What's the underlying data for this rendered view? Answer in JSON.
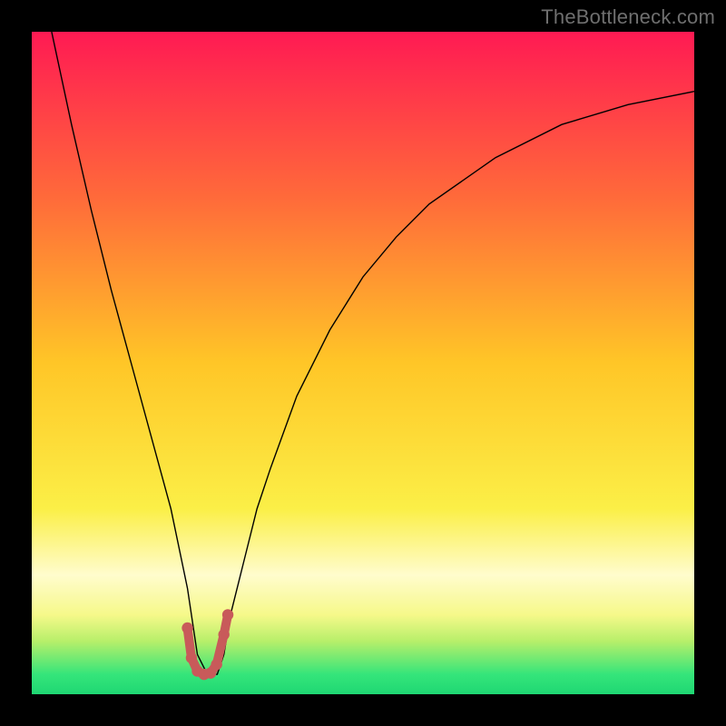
{
  "watermark": "TheBottleneck.com",
  "chart_data": {
    "type": "line",
    "title": "",
    "xlabel": "",
    "ylabel": "",
    "xlim": [
      0,
      100
    ],
    "ylim": [
      0,
      100
    ],
    "grid": false,
    "legend": false,
    "series": [
      {
        "name": "bottleneck-curve",
        "x": [
          3,
          6,
          9,
          12,
          15,
          18,
          21,
          23.5,
          25,
          26.5,
          28,
          29,
          30,
          32,
          34,
          36,
          40,
          45,
          50,
          55,
          60,
          70,
          80,
          90,
          100
        ],
        "y": [
          100,
          86,
          73,
          61,
          50,
          39,
          28,
          16,
          6,
          3,
          3,
          6,
          12,
          20,
          28,
          34,
          45,
          55,
          63,
          69,
          74,
          81,
          86,
          89,
          91
        ],
        "color": "#000000"
      },
      {
        "name": "sweet-spot",
        "x": [
          23.5,
          24.1,
          25,
          26,
          27,
          27.9,
          29,
          29.6
        ],
        "y": [
          10,
          5.5,
          3.5,
          3,
          3.2,
          4.5,
          9,
          12
        ],
        "color": "#c85a5a"
      }
    ],
    "background": {
      "type": "vertical-gradient",
      "stops": [
        {
          "pos": 0,
          "color": "#ff1a53"
        },
        {
          "pos": 25,
          "color": "#ff6a3a"
        },
        {
          "pos": 50,
          "color": "#ffc627"
        },
        {
          "pos": 72,
          "color": "#fbef47"
        },
        {
          "pos": 82,
          "color": "#fffccd"
        },
        {
          "pos": 88,
          "color": "#f6f98a"
        },
        {
          "pos": 92,
          "color": "#b7ef6a"
        },
        {
          "pos": 97,
          "color": "#35e57a"
        },
        {
          "pos": 100,
          "color": "#1fd773"
        }
      ]
    }
  }
}
